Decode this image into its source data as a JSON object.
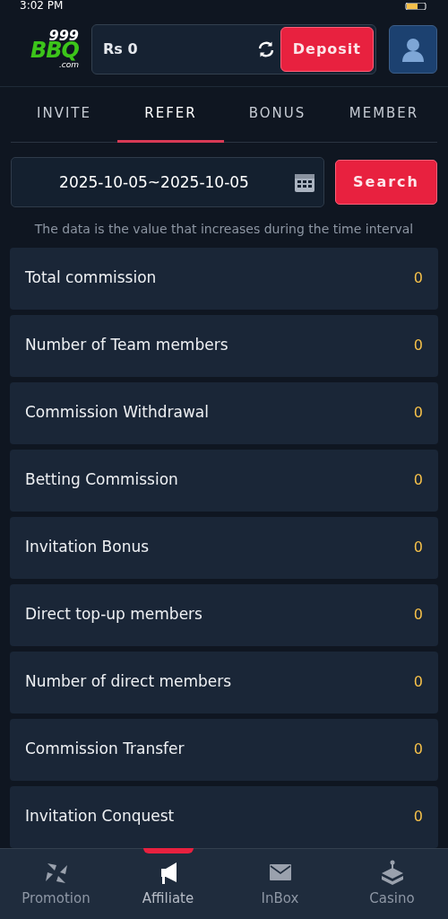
{
  "status_bar": {
    "time": "3:02 PM"
  },
  "header": {
    "logo": {
      "number": "999",
      "name": "BBQ",
      "domain": ".com"
    },
    "balance": "Rs 0",
    "deposit": "Deposit"
  },
  "tabs": [
    {
      "label": "INVITE",
      "selected": false
    },
    {
      "label": "REFER",
      "selected": true
    },
    {
      "label": "BONUS",
      "selected": false
    },
    {
      "label": "MEMBER",
      "selected": false
    }
  ],
  "date_range": {
    "value": "2025-10-05~2025-10-05"
  },
  "search_button": "Search",
  "note": "The data is the value that increases during the time interval",
  "stats": [
    {
      "label": "Total commission",
      "value": "0"
    },
    {
      "label": "Number of Team members",
      "value": "0"
    },
    {
      "label": "Commission Withdrawal",
      "value": "0"
    },
    {
      "label": "Betting Commission",
      "value": "0"
    },
    {
      "label": "Invitation Bonus",
      "value": "0"
    },
    {
      "label": "Direct top-up members",
      "value": "0"
    },
    {
      "label": "Number of direct members",
      "value": "0"
    },
    {
      "label": "Commission Transfer",
      "value": "0"
    },
    {
      "label": "Invitation Conquest",
      "value": "0"
    }
  ],
  "bottom_nav": [
    {
      "label": "Promotion",
      "kind": "pinwheel",
      "selected": false
    },
    {
      "label": "Affiliate",
      "kind": "megaphone",
      "selected": true
    },
    {
      "label": "InBox",
      "kind": "mail",
      "selected": false
    },
    {
      "label": "Casino",
      "kind": "joystick",
      "selected": false
    }
  ]
}
